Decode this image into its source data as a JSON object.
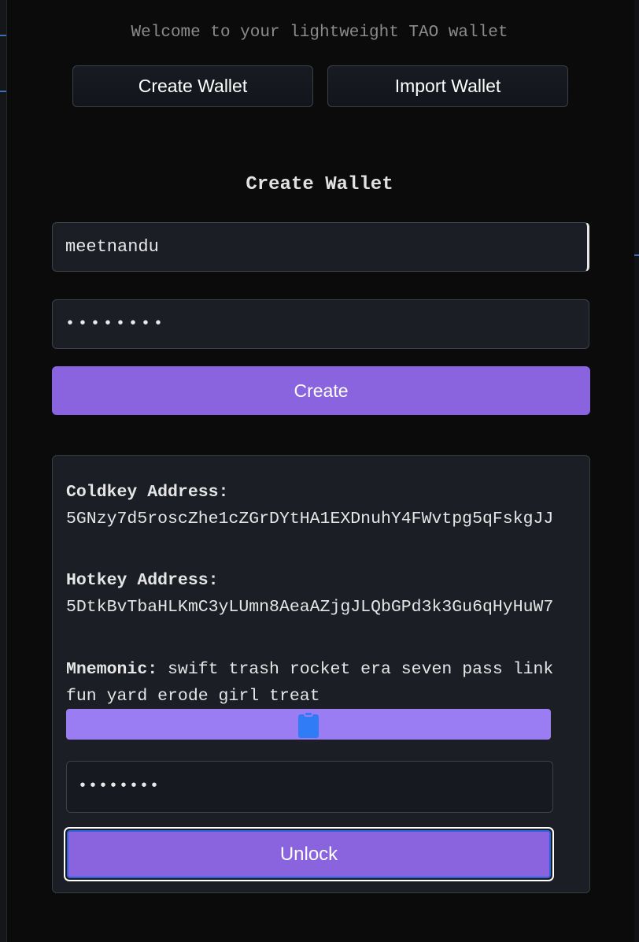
{
  "header": {
    "welcome": "Welcome to your lightweight TAO wallet",
    "tabs": [
      {
        "label": "Create Wallet"
      },
      {
        "label": "Import Wallet"
      }
    ]
  },
  "create_form": {
    "title": "Create Wallet",
    "name_value": "meetnandu",
    "password_value": "••••••••",
    "submit_label": "Create"
  },
  "result": {
    "coldkey": {
      "label": "Coldkey Address:",
      "value": "5GNzy7d5roscZhe1cZGrDYtHA1EXDnuhY4FWvtpg5qFskgJJ"
    },
    "hotkey": {
      "label": "Hotkey Address:",
      "value": "5DtkBvTbaHLKmC3yLUmn8AeaAZjgJLQbGPd3k3Gu6qHyHuW7"
    },
    "mnemonic": {
      "label": "Mnemonic:",
      "value": "swift trash rocket era seven pass link fun yard erode girl treat"
    },
    "copy_icon": "clipboard-icon",
    "unlock_password_value": "••••••••",
    "unlock_label": "Unlock"
  },
  "colors": {
    "background": "#0b0b0c",
    "accent": "#8a63df",
    "copy_bar": "#9a7df3",
    "clipboard": "#2f7cf6"
  }
}
